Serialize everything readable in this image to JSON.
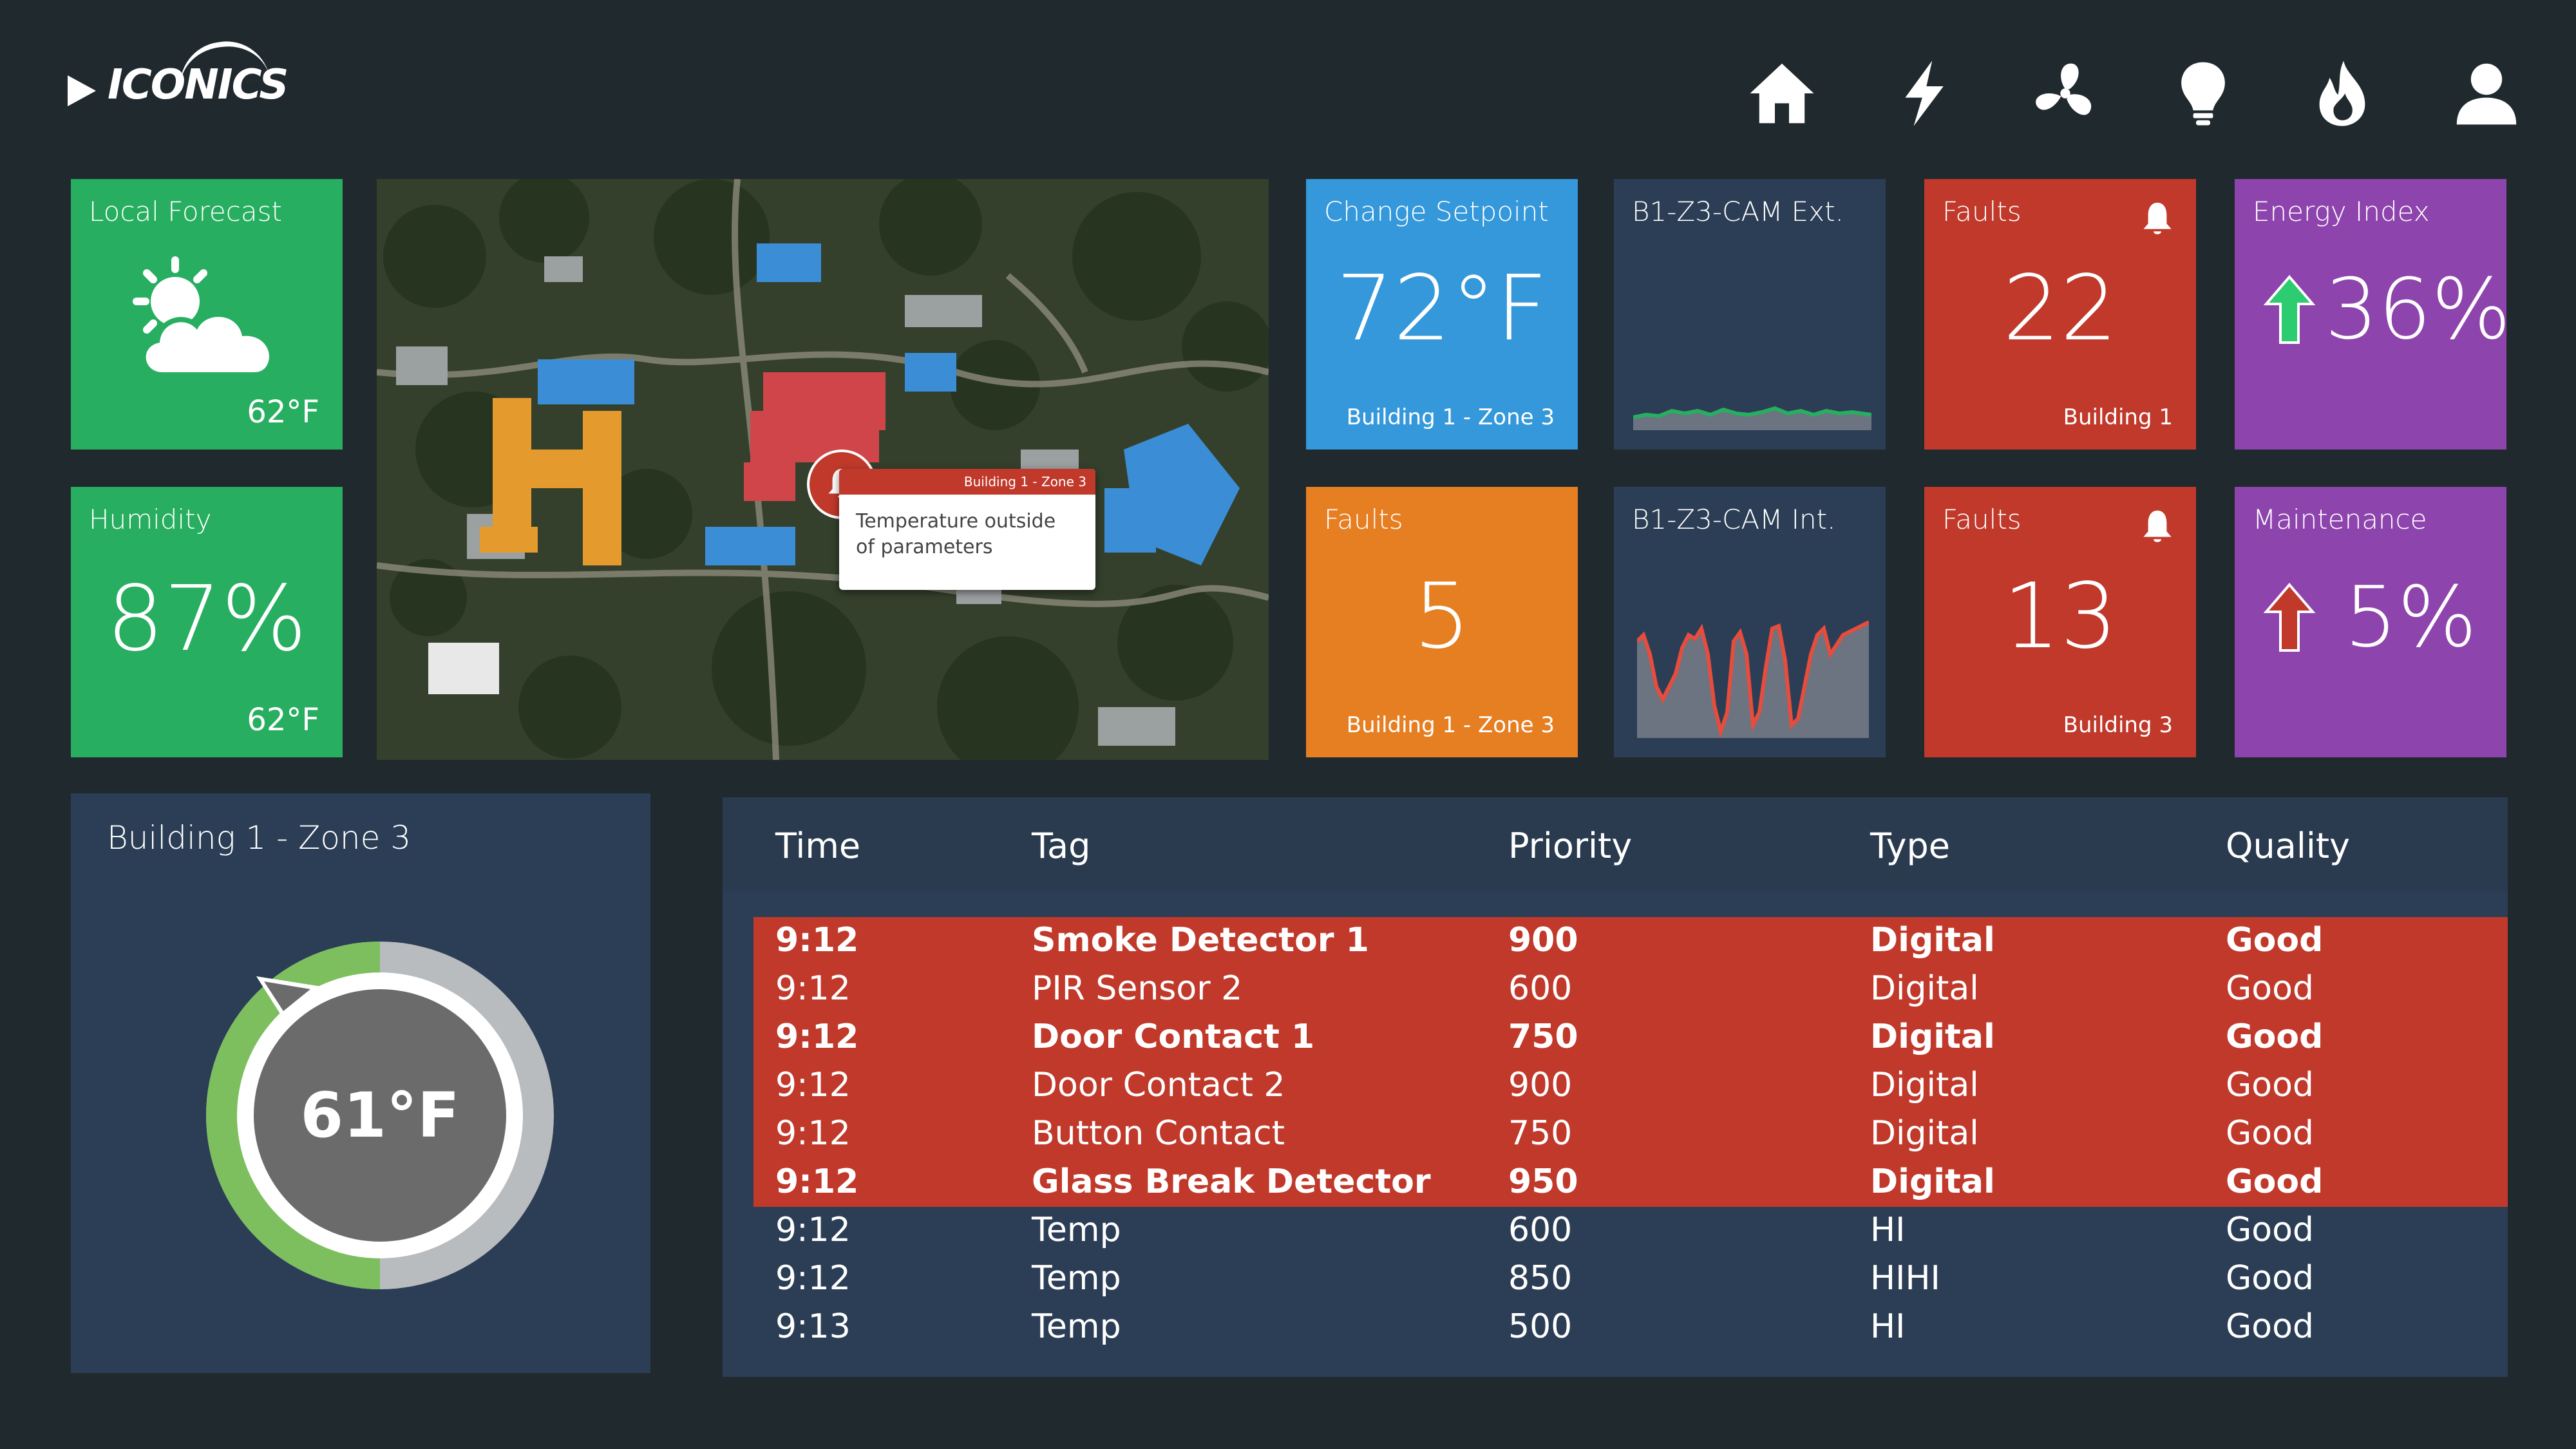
{
  "brand": {
    "name": "ICONICS"
  },
  "nav": [
    {
      "icon": "home-icon"
    },
    {
      "icon": "lightning-icon"
    },
    {
      "icon": "fan-icon"
    },
    {
      "icon": "lightbulb-icon"
    },
    {
      "icon": "flame-icon"
    },
    {
      "icon": "user-icon"
    }
  ],
  "tiles": {
    "forecast": {
      "label": "Local Forecast",
      "temp": "62°F",
      "icon": "partly-cloudy-icon",
      "color": "#27ae60"
    },
    "humidity": {
      "label": "Humidity",
      "value": "87%",
      "temp": "62°F",
      "color": "#27ae60"
    },
    "setpoint": {
      "label": "Change Setpoint",
      "value": "72°F",
      "location": "Building 1 - Zone 3",
      "color": "#3498db"
    },
    "faults_orange": {
      "label": "Faults",
      "value": "5",
      "location": "Building 1 - Zone 3",
      "color": "#e67e22"
    },
    "cam_ext": {
      "label": "B1-Z3-CAM Ext."
    },
    "cam_int": {
      "label": "B1-Z3-CAM Int."
    },
    "faults_b1": {
      "label": "Faults",
      "value": "22",
      "location": "Building 1",
      "icon": "bell-icon",
      "color": "#c0392b"
    },
    "faults_b3": {
      "label": "Faults",
      "value": "13",
      "location": "Building 3",
      "icon": "bell-icon",
      "color": "#c0392b"
    },
    "energy": {
      "label": "Energy Index",
      "value": "36%",
      "icon": "arrow-up-green-icon",
      "color": "#8e44ad"
    },
    "maintenance": {
      "label": "Maintenance",
      "value": "5%",
      "icon": "arrow-up-red-icon",
      "color": "#8e44ad"
    }
  },
  "map": {
    "popup_header": "Building 1 - Zone 3",
    "popup_line1": "Temperature outside",
    "popup_line2": "of parameters"
  },
  "gauge": {
    "title": "Building 1 - Zone 3",
    "value": "61°F",
    "fraction": 0.5
  },
  "alarms": {
    "columns": [
      "Time",
      "Tag",
      "Priority",
      "Type",
      "Quality"
    ],
    "rows": [
      {
        "time": "9:12",
        "tag": "Smoke Detector 1",
        "priority": "900",
        "type": "Digital",
        "quality": "Good",
        "alarm": true,
        "bold": true
      },
      {
        "time": "9:12",
        "tag": "PIR Sensor 2",
        "priority": "600",
        "type": "Digital",
        "quality": "Good",
        "alarm": true,
        "bold": false
      },
      {
        "time": "9:12",
        "tag": "Door Contact 1",
        "priority": "750",
        "type": "Digital",
        "quality": "Good",
        "alarm": true,
        "bold": true
      },
      {
        "time": "9:12",
        "tag": "Door Contact 2",
        "priority": "900",
        "type": "Digital",
        "quality": "Good",
        "alarm": true,
        "bold": false
      },
      {
        "time": "9:12",
        "tag": "Button Contact",
        "priority": "750",
        "type": "Digital",
        "quality": "Good",
        "alarm": true,
        "bold": false
      },
      {
        "time": "9:12",
        "tag": "Glass Break Detector",
        "priority": "950",
        "type": "Digital",
        "quality": "Good",
        "alarm": true,
        "bold": true
      },
      {
        "time": "9:12",
        "tag": "Temp",
        "priority": "600",
        "type": "HI",
        "quality": "Good",
        "alarm": false,
        "bold": false
      },
      {
        "time": "9:12",
        "tag": "Temp",
        "priority": "850",
        "type": "HIHI",
        "quality": "Good",
        "alarm": false,
        "bold": false
      },
      {
        "time": "9:13",
        "tag": "Temp",
        "priority": "500",
        "type": "HI",
        "quality": "Good",
        "alarm": false,
        "bold": false
      }
    ]
  },
  "colors": {
    "background": "#202a2e",
    "panel": "#2c3e55",
    "alarm_row": "#c0392b",
    "trend_green": "#27ae60",
    "trend_red": "#e74c3c"
  }
}
